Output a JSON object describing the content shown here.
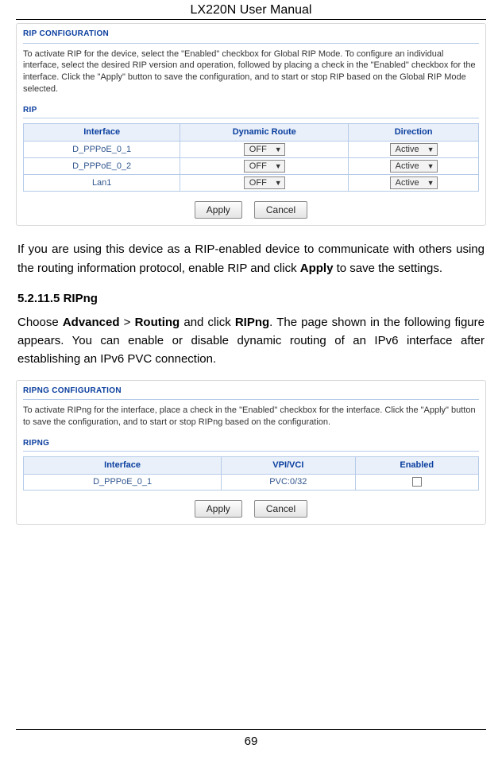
{
  "header": {
    "title": "LX220N User Manual"
  },
  "footer": {
    "page_number": "69"
  },
  "rip_panel": {
    "title": "RIP CONFIGURATION",
    "intro": "To activate RIP for the device, select the \"Enabled\" checkbox for Global RIP Mode. To configure an individual interface, select the desired RIP version and operation, followed by placing a check in the \"Enabled\" checkbox for the interface. Click the \"Apply\" button to save the configuration, and to start or stop RIP based on the Global RIP Mode selected.",
    "subtitle": "RIP",
    "table": {
      "headers": [
        "Interface",
        "Dynamic Route",
        "Direction"
      ],
      "rows": [
        {
          "interface": "D_PPPoE_0_1",
          "route": "OFF",
          "direction": "Active"
        },
        {
          "interface": "D_PPPoE_0_2",
          "route": "OFF",
          "direction": "Active"
        },
        {
          "interface": "Lan1",
          "route": "OFF",
          "direction": "Active"
        }
      ]
    },
    "buttons": {
      "apply": "Apply",
      "cancel": "Cancel"
    }
  },
  "narrative": {
    "para1_a": "If you are using this device as a RIP-enabled device to communicate with others using the routing information protocol, enable RIP and click ",
    "para1_bold": "Apply",
    "para1_b": " to save the settings.",
    "heading_num": "5.2.11.5",
    "heading_txt": "RIPng",
    "para2_a": "Choose ",
    "para2_b1": "Advanced",
    "para2_gt": " > ",
    "para2_b2": "Routing",
    "para2_c": " and click ",
    "para2_b3": "RIPng",
    "para2_d": ". The page shown in the following figure appears. You can enable or disable dynamic routing of an IPv6 interface after establishing an IPv6 PVC connection."
  },
  "ripng_panel": {
    "title": "RIPNG CONFIGURATION",
    "intro": "To activate RIPng for the interface, place a check in the \"Enabled\" checkbox for the interface. Click the \"Apply\" button to save the configuration, and to start or stop RIPng based on the configuration.",
    "subtitle": "RIPNG",
    "table": {
      "headers": [
        "Interface",
        "VPI/VCI",
        "Enabled"
      ],
      "rows": [
        {
          "interface": "D_PPPoE_0_1",
          "vpi_vci": "PVC:0/32"
        }
      ]
    },
    "buttons": {
      "apply": "Apply",
      "cancel": "Cancel"
    }
  }
}
